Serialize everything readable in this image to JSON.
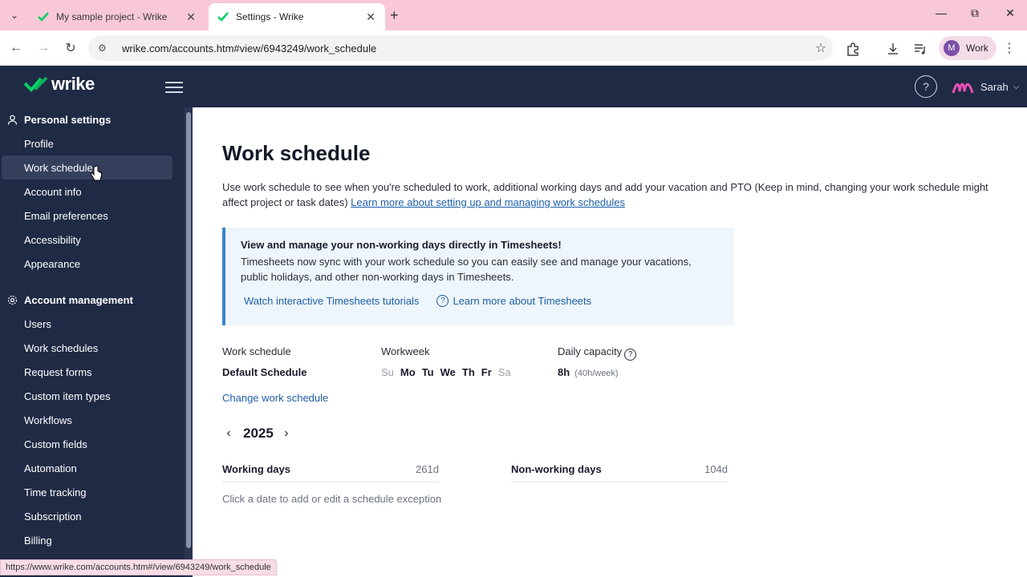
{
  "browser": {
    "tabs": [
      {
        "title": "My sample project - Wrike",
        "active": false
      },
      {
        "title": "Settings - Wrike",
        "active": true
      }
    ],
    "url": "wrike.com/accounts.htm#view/6943249/work_schedule",
    "profile_label": "Work",
    "profile_initial": "M",
    "status_url": "https://www.wrike.com/accounts.htm#/view/6943249/work_schedule"
  },
  "header": {
    "logo_text": "wrike",
    "user_name": "Sarah"
  },
  "sidebar": {
    "personal_title": "Personal settings",
    "personal_items": [
      "Profile",
      "Work schedule",
      "Account info",
      "Email preferences",
      "Accessibility",
      "Appearance"
    ],
    "account_title": "Account management",
    "account_items": [
      "Users",
      "Work schedules",
      "Request forms",
      "Custom item types",
      "Workflows",
      "Custom fields",
      "Automation",
      "Time tracking",
      "Subscription",
      "Billing"
    ],
    "selected_item": "Work schedule"
  },
  "main": {
    "title": "Work schedule",
    "intro_text": "Use work schedule to see when you're scheduled to work, additional working days and add your vacation and PTO (Keep in mind, changing your work schedule might affect project or task dates) ",
    "intro_link": "Learn more about setting up and managing work schedules",
    "banner": {
      "title": "View and manage your non-working days directly in Timesheets!",
      "body": "Timesheets now sync with your work schedule so you can easily see and manage your vacations, public holidays, and other non-working days in Timesheets.",
      "link1": "Watch interactive Timesheets tutorials",
      "link2": "Learn more about Timesheets"
    },
    "schedule_label": "Work schedule",
    "schedule_value": "Default Schedule",
    "workweek_label": "Workweek",
    "days": [
      "Su",
      "Mo",
      "Tu",
      "We",
      "Th",
      "Fr",
      "Sa"
    ],
    "capacity_label": "Daily capacity",
    "capacity_value": "8h",
    "capacity_sub": "(40h/week)",
    "change_link": "Change work schedule",
    "year": "2025",
    "working_days_label": "Working days",
    "working_days_value": "261d",
    "nonworking_days_label": "Non-working days",
    "nonworking_days_value": "104d",
    "hint": "Click a date to add or edit a schedule exception"
  },
  "colors": {
    "sidebar_bg": "#1f2a44",
    "accent_link": "#1d5fa8",
    "banner_bg": "#eef6fb",
    "wrike_green": "#08cf65"
  }
}
